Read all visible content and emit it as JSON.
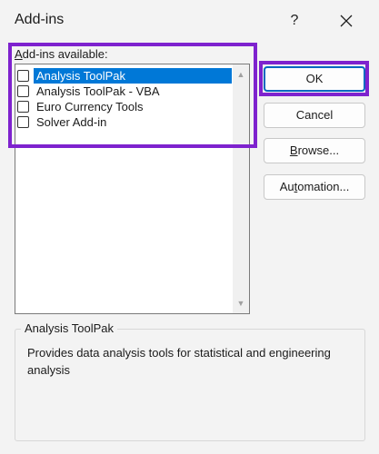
{
  "window": {
    "title": "Add-ins",
    "help_label": "?",
    "close_icon": "close-icon"
  },
  "addins": {
    "label_prefix": "A",
    "label_rest": "dd-ins available:",
    "items": [
      {
        "label": "Analysis ToolPak",
        "checked": false,
        "selected": true
      },
      {
        "label": "Analysis ToolPak - VBA",
        "checked": false,
        "selected": false
      },
      {
        "label": "Euro Currency Tools",
        "checked": false,
        "selected": false
      },
      {
        "label": "Solver Add-in",
        "checked": false,
        "selected": false
      }
    ]
  },
  "buttons": {
    "ok": "OK",
    "cancel": "Cancel",
    "browse_prefix": "B",
    "browse_rest": "rowse...",
    "automation_prefix": "Au",
    "automation_mid": "t",
    "automation_rest": "omation..."
  },
  "description": {
    "title": "Analysis ToolPak",
    "text": "Provides data analysis tools for statistical and engineering analysis"
  },
  "colors": {
    "selection": "#0078d7",
    "highlight_box": "#7e22ce"
  }
}
